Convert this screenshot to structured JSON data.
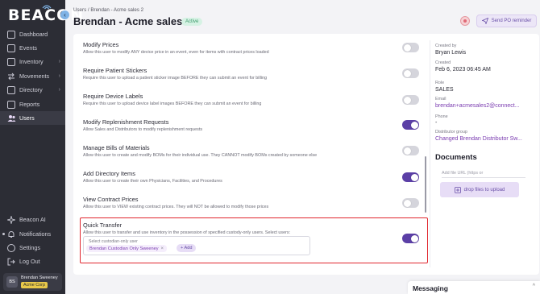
{
  "sidebar": {
    "logo": "BEACON",
    "collapse_icon": "‹",
    "items": [
      {
        "label": "Dashboard",
        "icon": "dashboard-icon",
        "chevron": ""
      },
      {
        "label": "Events",
        "icon": "calendar-icon",
        "chevron": ""
      },
      {
        "label": "Inventory",
        "icon": "box-icon",
        "chevron": "›"
      },
      {
        "label": "Movements",
        "icon": "arrows-icon",
        "chevron": "›"
      },
      {
        "label": "Directory",
        "icon": "directory-icon",
        "chevron": "›"
      },
      {
        "label": "Reports",
        "icon": "reports-icon",
        "chevron": ""
      },
      {
        "label": "Users",
        "icon": "users-icon",
        "chevron": ""
      }
    ],
    "bottom_items": [
      {
        "label": "Beacon AI",
        "icon": "sparkle-icon"
      },
      {
        "label": "Notifications",
        "icon": "bell-icon"
      },
      {
        "label": "Settings",
        "icon": "gear-icon"
      },
      {
        "label": "Log Out",
        "icon": "logout-icon"
      }
    ],
    "user": {
      "initials": "BS",
      "name": "Brendan Sweeney",
      "org": "Acme Corp"
    }
  },
  "header": {
    "breadcrumb": [
      "Users",
      "/",
      "Brendan - Acme sales 2"
    ],
    "title": "Brendan - Acme sales 2",
    "status": "Active",
    "po_button": "Send PO reminder"
  },
  "settings": [
    {
      "title": "Modify Prices",
      "desc": "Allow this user to modify ANY device price in an event, even for items with contract prices loaded",
      "enabled": false
    },
    {
      "title": "Require Patient Stickers",
      "desc": "Require this user to upload a patient sticker image BEFORE they can submit an event for billing",
      "enabled": false
    },
    {
      "title": "Require Device Labels",
      "desc": "Require this user to upload device label images BEFORE they can submit an event for billing",
      "enabled": false
    },
    {
      "title": "Modify Replenishment Requests",
      "desc": "Allow Sales and Distributors to modify replenishment requests",
      "enabled": true
    },
    {
      "title": "Manage Bills of Materials",
      "desc": "Allow this user to create and modify BOMs for their individual use. They CANNOT modify BOMs created by someone else",
      "enabled": false
    },
    {
      "title": "Add Directory Items",
      "desc": "Allow this user to create their own Physicians, Facilities, and Procedures",
      "enabled": true
    },
    {
      "title": "View Contract Prices",
      "desc": "Allow this user to VIEW existing contract prices. They will NOT be allowed to modify those prices",
      "enabled": false
    },
    {
      "title": "Quick Transfer",
      "desc": "Allow this user to transfer and use inventory in the possession of specified custody-only users. Select users:",
      "enabled": true
    }
  ],
  "quick_transfer": {
    "select_label": "Select custodian-only user",
    "chip": "Brendan Custodian Only Sweeney",
    "chip_remove": "×",
    "add_label": "+ Add"
  },
  "details": {
    "created_by_label": "Created by",
    "created_by": "Bryan Lewis",
    "created_label": "Created",
    "created": "Feb 6, 2023 06:45 AM",
    "role_label": "Role",
    "role": "SALES",
    "email_label": "Email",
    "email": "brendan+acmesales2@connect...",
    "phone_label": "Phone",
    "phone": "-",
    "distributor_label": "Distributor group",
    "distributor": "Changed Brendan Distributor Sw...",
    "documents_title": "Documents",
    "file_placeholder": "Add file URL (https or",
    "upload_label": "drop files to upload"
  },
  "messaging": {
    "title": "Messaging",
    "chevron": "^"
  },
  "colors": {
    "accent": "#5b3fa6",
    "highlight": "#e0262e",
    "status_bg": "#d6f2e4",
    "sidebar_bg": "#2c2d35"
  }
}
